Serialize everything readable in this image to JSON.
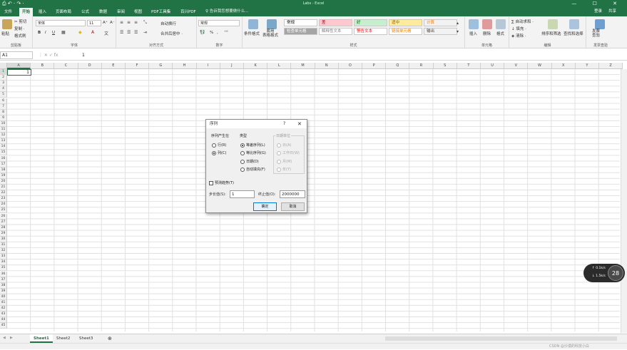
{
  "titlebar": {
    "qat": "⎙ ↶ · ↷ ·",
    "title": "Labs - Excel",
    "controls": "— ☐ ✕"
  },
  "tabs": [
    "文件",
    "开始",
    "插入",
    "页面布局",
    "公式",
    "数据",
    "审阅",
    "视图",
    "PDF工具集",
    "百兴PDF"
  ],
  "active_tab": "开始",
  "tell_me": "♀ 告诉我您想要做什么...",
  "login": "登录",
  "share": "共享",
  "ribbon": {
    "clipboard": {
      "paste": "粘贴",
      "cut": "✂ 剪切",
      "copy": "复制 ·",
      "format_painter": "格式刷",
      "label": "剪贴板"
    },
    "font": {
      "name": "宋体",
      "size": "11",
      "grow": "A⁺",
      "shrink": "A⁻",
      "bold": "B",
      "italic": "I",
      "underline": "U",
      "label": "字体"
    },
    "align": {
      "wrap": "自动换行",
      "merge": "合并后居中 ·",
      "label": "对齐方式"
    },
    "number": {
      "format": "常规",
      "percent": "%",
      "comma": ",",
      "label": "数字"
    },
    "styles": {
      "cond": "条件格式",
      "table": "套用\n表格格式",
      "cells": [
        {
          "text": "常规",
          "bg": "#ffffff",
          "color": "#000000"
        },
        {
          "text": "差",
          "bg": "#ffc7ce",
          "color": "#9c0006"
        },
        {
          "text": "好",
          "bg": "#c6efce",
          "color": "#006100"
        },
        {
          "text": "适中",
          "bg": "#ffeb9c",
          "color": "#9c5700"
        },
        {
          "text": "计算",
          "bg": "#f2f2f2",
          "color": "#fa7d00"
        },
        {
          "text": "检查单元格",
          "bg": "#a5a5a5",
          "color": "#ffffff"
        },
        {
          "text": "解释性文本",
          "bg": "#ffffff",
          "color": "#7f7f7f"
        },
        {
          "text": "警告文本",
          "bg": "#ffffff",
          "color": "#ff0000"
        },
        {
          "text": "链接单元格",
          "bg": "#ffffff",
          "color": "#fa7d00"
        },
        {
          "text": "输出",
          "bg": "#f2f2f2",
          "color": "#3f3f3f"
        }
      ],
      "label": "样式"
    },
    "cells": {
      "insert": "插入",
      "delete": "删除",
      "format": "格式",
      "label": "单元格"
    },
    "edit": {
      "autosum": "∑ 自动求和 ·",
      "fill": "↓ 填充 ·",
      "clear": "◈ 清除 ·",
      "sort": "排序和筛选",
      "find": "查找和选择",
      "label": "编辑"
    },
    "invoice": {
      "btn": "发票\n查验",
      "label": "发票查验"
    }
  },
  "formula_bar": {
    "name_box": "A1",
    "symbols": "⋮  ✕  ✓  fx",
    "value": "1"
  },
  "columns": [
    "A",
    "B",
    "C",
    "D",
    "E",
    "F",
    "G",
    "H",
    "I",
    "J",
    "K",
    "L",
    "M",
    "N",
    "O",
    "P",
    "Q",
    "R",
    "S",
    "T",
    "U",
    "V",
    "W",
    "X",
    "Y",
    "Z"
  ],
  "rows": [
    "1",
    "2",
    "3",
    "4",
    "5",
    "6",
    "7",
    "8",
    "9",
    "10",
    "11",
    "12",
    "13",
    "14",
    "15",
    "16",
    "17",
    "18",
    "19",
    "20",
    "21",
    "22",
    "23",
    "24",
    "25",
    "26",
    "27",
    "28",
    "29",
    "30",
    "31",
    "32",
    "33",
    "34",
    "35",
    "36",
    "37",
    "38",
    "39",
    "40",
    "41",
    "42",
    "43",
    "44",
    "45"
  ],
  "cell_a1": "1",
  "sheets": [
    "Sheet1",
    "Sheet2",
    "Sheet3"
  ],
  "active_sheet": "Sheet1",
  "add_sheet": "⊕",
  "dialog": {
    "title": "序列",
    "help": "?",
    "close": "✕",
    "series_in": {
      "label": "序列产生在",
      "options": [
        "行(R)",
        "列(C)"
      ],
      "selected": 1
    },
    "type": {
      "label": "类型",
      "options": [
        "等差序列(L)",
        "等比序列(G)",
        "日期(D)",
        "自动填充(F)"
      ],
      "selected": 0
    },
    "date_unit": {
      "label": "日期单位",
      "options": [
        "日(A)",
        "工作日(W)",
        "月(M)",
        "年(Y)"
      ]
    },
    "trend": "预测趋势(T)",
    "step_label": "步长值(S):",
    "step_value": "1",
    "stop_label": "终止值(O):",
    "stop_value": "2000000",
    "ok": "确定",
    "cancel": "取消"
  },
  "widget": {
    "up": "↑ 0.1k/s",
    "down": "↓ 1.5k/s",
    "percent": "28"
  },
  "watermark": "CSDN @沙漠的科技小白"
}
